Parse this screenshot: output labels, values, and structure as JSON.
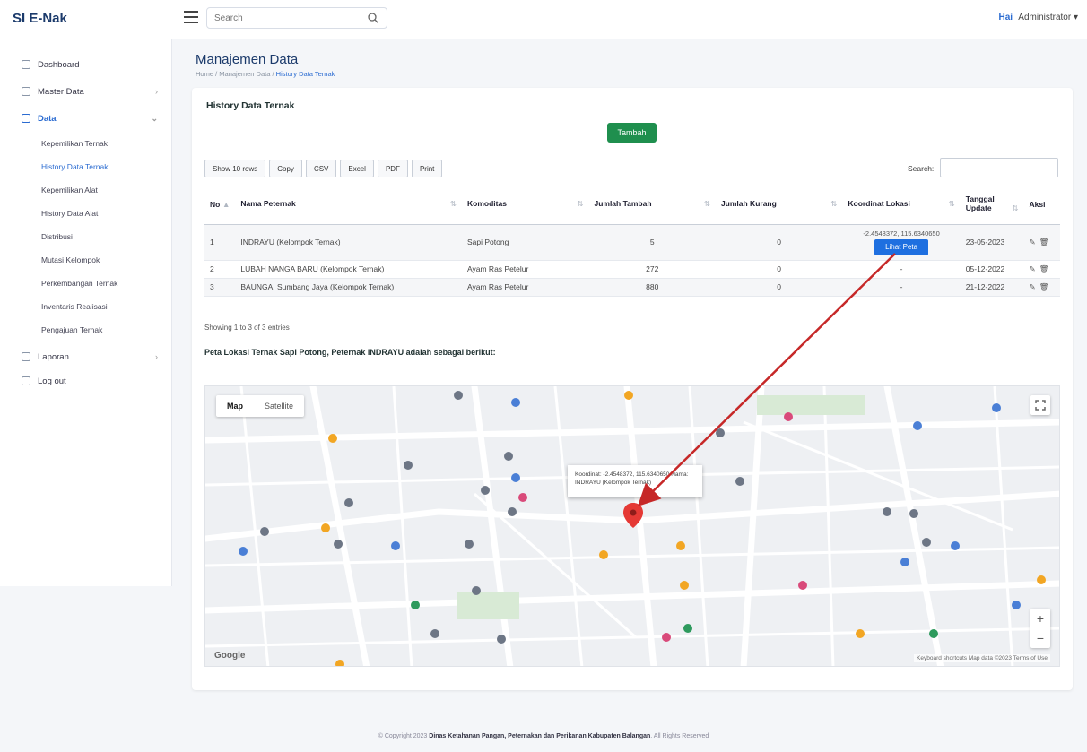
{
  "app": {
    "brand": "SI E-Nak"
  },
  "header": {
    "search_placeholder": "Search",
    "user_role": "Hai",
    "user_name": "Administrator"
  },
  "sidebar": {
    "items": [
      {
        "label": "Dashboard"
      },
      {
        "label": "Master Data"
      },
      {
        "label": "Data"
      },
      {
        "label": "Laporan"
      },
      {
        "label": "Log out"
      }
    ],
    "sub_items": [
      {
        "label": "Kepemilikan Ternak"
      },
      {
        "label": "History Data Ternak"
      },
      {
        "label": "Kepemilikan Alat"
      },
      {
        "label": "History Data Alat"
      },
      {
        "label": "Distribusi"
      },
      {
        "label": "Mutasi Kelompok"
      },
      {
        "label": "Perkembangan Ternak"
      },
      {
        "label": "Inventaris Realisasi"
      },
      {
        "label": "Pengajuan Ternak"
      }
    ]
  },
  "page": {
    "title": "Manajemen Data",
    "breadcrumb_home": "Home",
    "breadcrumb_mid": "Manajemen Data",
    "breadcrumb_current": "History Data Ternak"
  },
  "card": {
    "title": "History Data Ternak",
    "green_button": "Tambah",
    "dt_buttons": [
      "Show 10 rows",
      "Copy",
      "CSV",
      "Excel",
      "PDF",
      "Print"
    ],
    "search_label": "Search:",
    "columns": [
      "No",
      "Nama Peternak",
      "Komoditas",
      "Jumlah Tambah",
      "Jumlah Kurang",
      "Koordinat Lokasi",
      "Tanggal Update",
      "Aksi"
    ],
    "rows": [
      {
        "no": "1",
        "nama": "INDRAYU (Kelompok Ternak)",
        "komoditas": "Sapi Potong",
        "tambah": "5",
        "kurang": "0",
        "koordinat": "-2.4548372, 115.6340650",
        "map_button": "Lihat Peta",
        "tanggal": "23-05-2023"
      },
      {
        "no": "2",
        "nama": "LUBAH NANGA BARU (Kelompok Ternak)",
        "komoditas": "Ayam Ras Petelur",
        "tambah": "272",
        "kurang": "0",
        "koordinat": "-",
        "tanggal": "05-12-2022"
      },
      {
        "no": "3",
        "nama": "BAUNGAI Sumbang Jaya (Kelompok Ternak)",
        "komoditas": "Ayam Ras Petelur",
        "tambah": "880",
        "kurang": "0",
        "koordinat": "-",
        "tanggal": "21-12-2022"
      }
    ],
    "info": "Showing 1 to 3 of 3 entries",
    "map_caption": "Peta Lokasi Ternak Sapi Potong, Peternak INDRAYU adalah sebagai berikut:"
  },
  "map": {
    "toggle_map": "Map",
    "toggle_sat": "Satellite",
    "tooltip": "Koordinat: -2.4548372, 115.6340650 Nama: INDRAYU (Kelompok Ternak)",
    "google": "Google",
    "attribution": "Keyboard shortcuts  Map data ©2023  Terms of Use",
    "zoom_in": "+",
    "zoom_out": "−",
    "colors": {
      "marker": "#e53935",
      "arrow": "#c62828",
      "poi_blue": "#4a7fd6",
      "poi_orange": "#f2a623",
      "poi_green": "#2e9a5d",
      "poi_pink": "#d94a7a",
      "poi_gray": "#6d7685"
    }
  },
  "footer": {
    "prefix": "© Copyright 2023",
    "org": "Dinas Ketahanan Pangan, Peternakan dan Perikanan Kabupaten Balangan",
    "suffix": ". All Rights Reserved"
  }
}
